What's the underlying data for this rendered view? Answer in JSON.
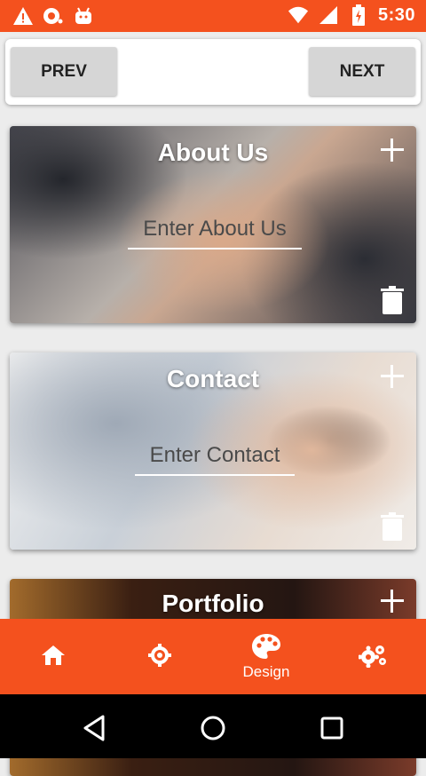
{
  "status_bar": {
    "time": "5:30",
    "left_icons": [
      "warning-icon",
      "notification-icon",
      "android-icon"
    ],
    "right_icons": [
      "wifi-icon",
      "signal-icon",
      "battery-icon"
    ]
  },
  "nav": {
    "prev_label": "PREV",
    "next_label": "NEXT"
  },
  "sections": {
    "about": {
      "title": "About Us",
      "placeholder": "Enter About Us"
    },
    "contact": {
      "title": "Contact",
      "placeholder": "Enter Contact"
    },
    "portfolio": {
      "title": "Portfolio"
    }
  },
  "bottom_nav": {
    "items": [
      {
        "icon": "home-icon",
        "label": ""
      },
      {
        "icon": "crosshair-icon",
        "label": ""
      },
      {
        "icon": "palette-icon",
        "label": "Design"
      },
      {
        "icon": "settings-icon",
        "label": ""
      }
    ]
  },
  "colors": {
    "accent": "#f4511e",
    "nav_button": "#d6d6d6"
  }
}
